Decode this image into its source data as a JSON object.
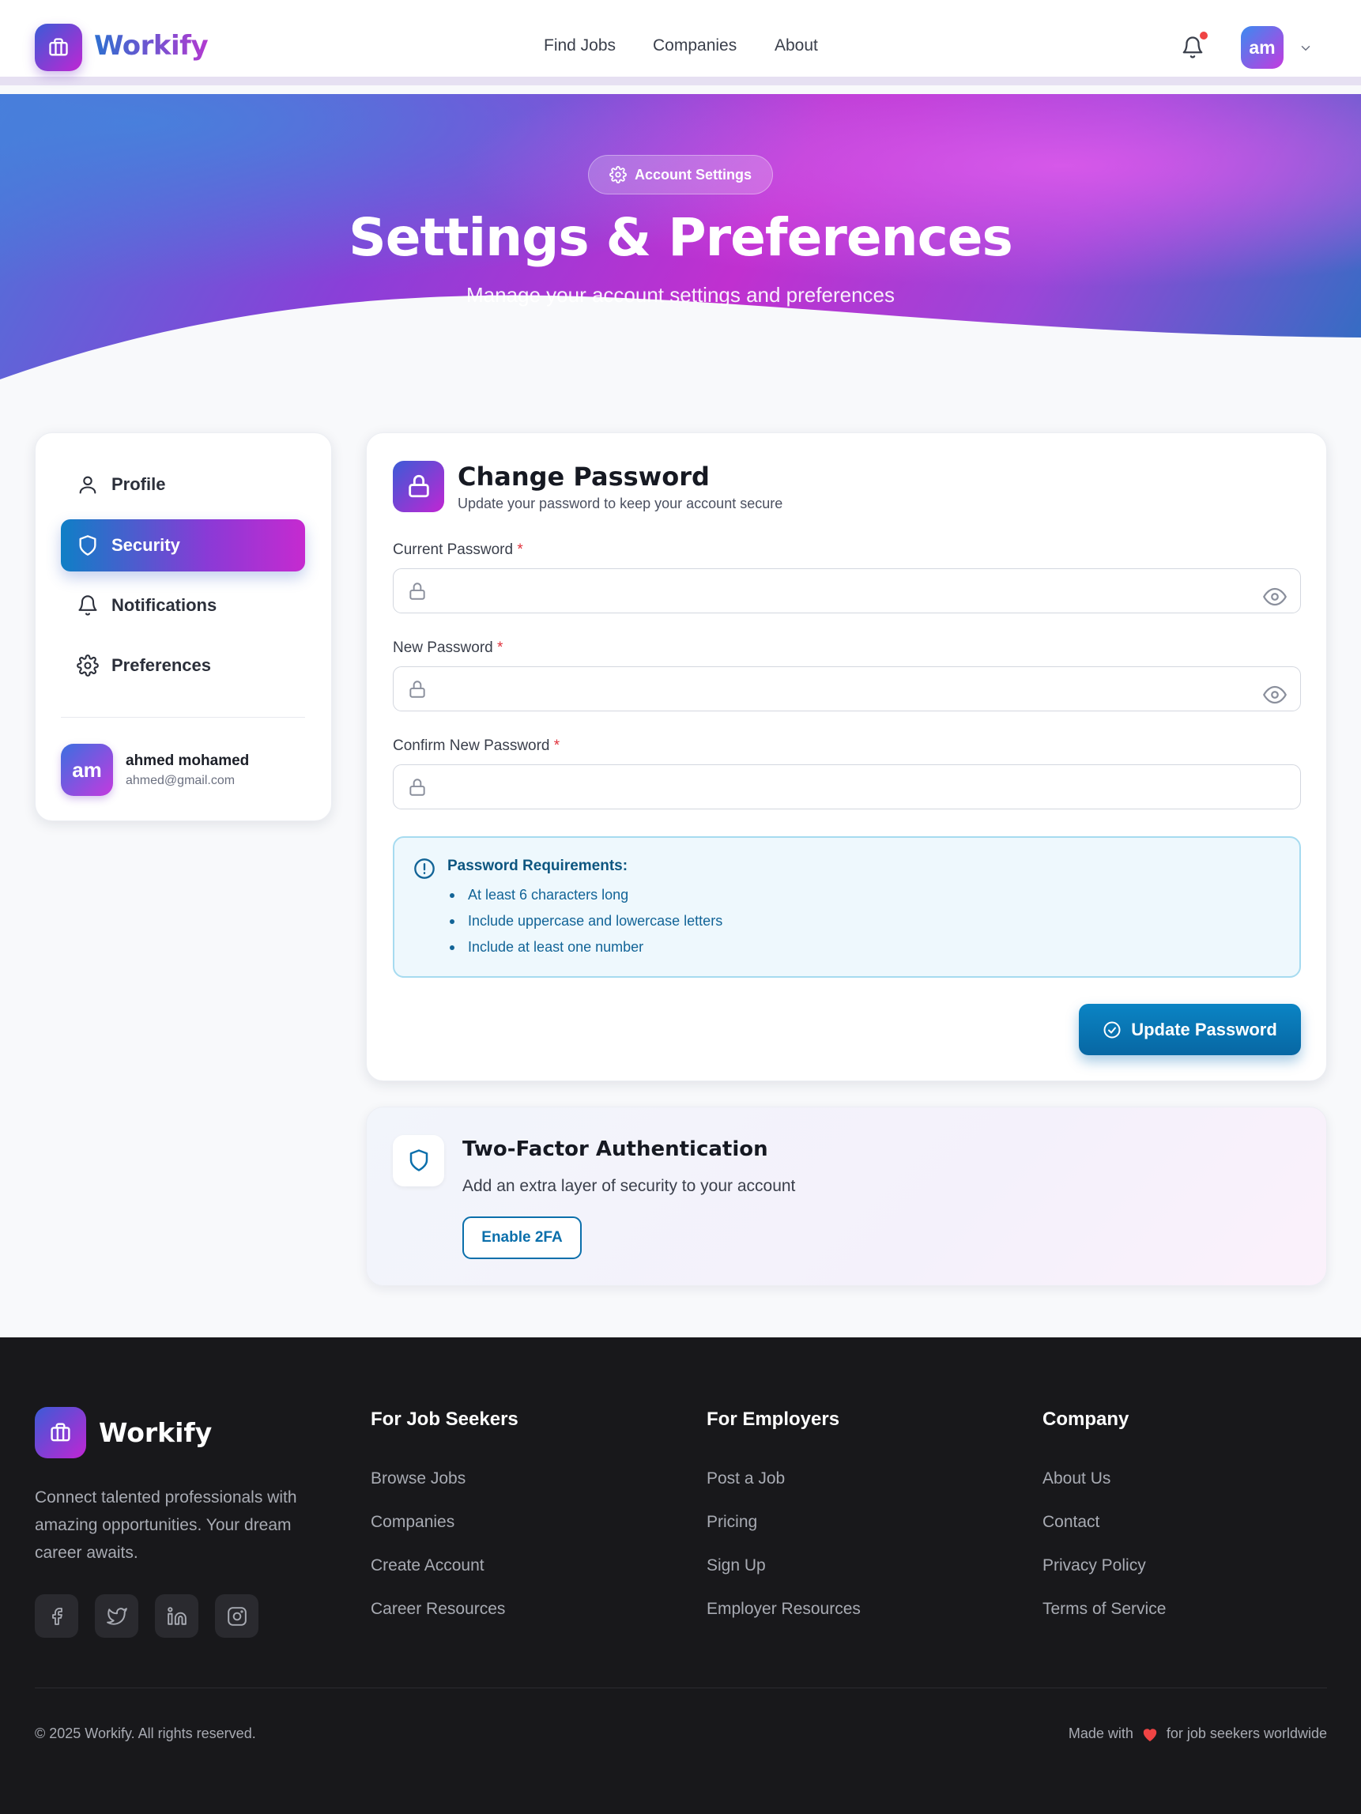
{
  "header": {
    "brand": "Workify",
    "nav": [
      "Find Jobs",
      "Companies",
      "About"
    ],
    "avatar_initials": "am",
    "notification_dot": true
  },
  "hero": {
    "badge": "Account Settings",
    "title": "Settings & Preferences",
    "subtitle": "Manage your account settings and preferences"
  },
  "sidebar": {
    "items": [
      {
        "label": "Profile",
        "icon": "user-icon",
        "active": false
      },
      {
        "label": "Security",
        "icon": "shield-icon",
        "active": true
      },
      {
        "label": "Notifications",
        "icon": "bell-icon",
        "active": false
      },
      {
        "label": "Preferences",
        "icon": "gear-icon",
        "active": false
      }
    ],
    "user": {
      "initials": "am",
      "name": "ahmed mohamed",
      "email": "ahmed@gmail.com"
    }
  },
  "change_password": {
    "title": "Change Password",
    "subtitle": "Update your password to keep your account secure",
    "fields": [
      {
        "label": "Current Password",
        "required": "*",
        "value": "",
        "placeholder": ""
      },
      {
        "label": "New Password",
        "required": "*",
        "value": "",
        "placeholder": ""
      },
      {
        "label": "Confirm New Password",
        "required": "*",
        "value": "",
        "placeholder": ""
      }
    ],
    "requirements_title": "Password Requirements:",
    "requirements": [
      "At least 6 characters long",
      "Include uppercase and lowercase letters",
      "Include at least one number"
    ],
    "submit_label": "Update Password"
  },
  "two_factor": {
    "title": "Two-Factor Authentication",
    "subtitle": "Add an extra layer of security to your account",
    "button_label": "Enable 2FA"
  },
  "footer": {
    "brand": "Workify",
    "description": "Connect talented professionals with amazing opportunities. Your dream career awaits.",
    "social": [
      "facebook-icon",
      "twitter-icon",
      "linkedin-icon",
      "instagram-icon"
    ],
    "columns": [
      {
        "title": "For Job Seekers",
        "links": [
          "Browse Jobs",
          "Companies",
          "Create Account",
          "Career Resources"
        ]
      },
      {
        "title": "For Employers",
        "links": [
          "Post a Job",
          "Pricing",
          "Sign Up",
          "Employer Resources"
        ]
      },
      {
        "title": "Company",
        "links": [
          "About Us",
          "Contact",
          "Privacy Policy",
          "Terms of Service"
        ]
      }
    ],
    "copyright": "© 2025 Workify. All rights reserved.",
    "made_with_before": "Made with",
    "made_with_after": "for job seekers worldwide"
  },
  "colors": {
    "accent": "#0b6fab",
    "brand_gradient_start": "#3b5bd6",
    "brand_gradient_end": "#c026d3",
    "required": "#e0323c",
    "footer_bg": "#18181b"
  }
}
